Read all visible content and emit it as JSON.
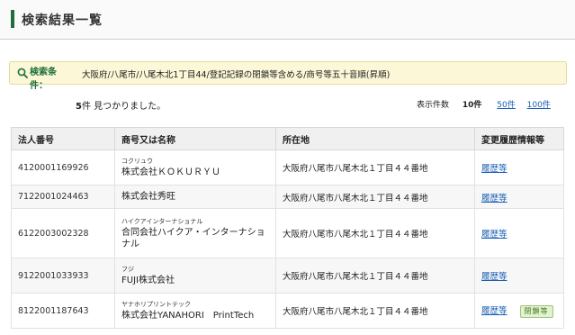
{
  "header": {
    "title": "検索結果一覧"
  },
  "criteria": {
    "label": "検索条件：",
    "text": "大阪府/八尾市/八尾木北1丁目44/登記記録の閉鎖等含める/商号等五十音順(昇順)"
  },
  "result_count": {
    "number": "5",
    "text": "件 見つかりました。"
  },
  "per_page": {
    "label": "表示件数",
    "current": "10件",
    "options": [
      "50件",
      "100件"
    ]
  },
  "table": {
    "headers": [
      "法人番号",
      "商号又は名称",
      "所在地",
      "変更履歴情報等"
    ],
    "rows": [
      {
        "number": "4120001169926",
        "furigana": "コクリュウ",
        "name": "株式会社ＫＯＫＵＲＹＵ",
        "address": "大阪府八尾市八尾木北１丁目４４番地",
        "history": "履歴等",
        "badge": ""
      },
      {
        "number": "7122001024463",
        "furigana": "",
        "name": "株式会社秀旺",
        "address": "大阪府八尾市八尾木北１丁目４４番地",
        "history": "履歴等",
        "badge": ""
      },
      {
        "number": "6122003002328",
        "furigana": "ハイクアインターナショナル",
        "name": "合同会社ハイクア・インターナショナル",
        "address": "大阪府八尾市八尾木北１丁目４４番地",
        "history": "履歴等",
        "badge": ""
      },
      {
        "number": "9122001033933",
        "furigana": "フジ",
        "name": "FUJI株式会社",
        "address": "大阪府八尾市八尾木北１丁目４４番地",
        "history": "履歴等",
        "badge": ""
      },
      {
        "number": "8122001187643",
        "furigana": "ヤナホリプリントテック",
        "name": "株式会社YANAHORI　PrintTech",
        "address": "大阪府八尾市八尾木北１丁目４４番地",
        "history": "履歴等",
        "badge": "閉鎖等"
      }
    ]
  },
  "colors": {
    "accent": "#1e6f3a",
    "link": "#1a5fb4",
    "criteria_bg": "#fbf7d7"
  }
}
